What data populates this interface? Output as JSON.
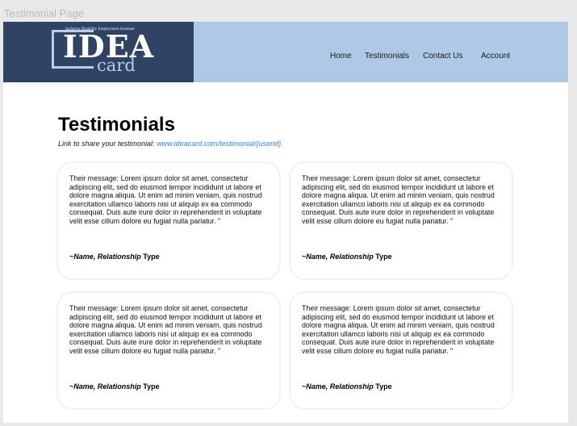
{
  "frame_label": "Testimonial Page",
  "logo": {
    "tagline": "Inclusive Disability Employment Assistant",
    "word1": "IDEA",
    "word2": "card"
  },
  "nav": {
    "home": "Home",
    "testimonials": "Testimonials",
    "contact": "Contact Us",
    "account": "Account"
  },
  "heading": "Testimonials",
  "share": {
    "label": "Link to share your testimonial:",
    "url": "www.ideacard.com/testimonial/{userid}"
  },
  "testimonials": [
    {
      "message": "Their message: Lorem ipsum dolor sit amet, consectetur adipiscing elit, sed do eiusmod tempor incididunt ut labore et dolore magna aliqua. Ut enim ad minim veniam, quis nostrud exercitation ullamco laboris nisi ut aliquip ex ea commodo consequat. Duis aute irure dolor in reprehenderit in voluptate velit esse cillum dolore eu fugiat nulla pariatur. \"",
      "signature": "~Name, Relationship",
      "type": "Type"
    },
    {
      "message": "Their message: Lorem ipsum dolor sit amet, consectetur adipiscing elit, sed do eiusmod tempor incididunt ut labore et dolore magna aliqua. Ut enim ad minim veniam, quis nostrud exercitation ullamco laboris nisi ut aliquip ex ea commodo consequat. Duis aute irure dolor in reprehenderit in voluptate velit esse cillum dolore eu fugiat nulla pariatur. \"",
      "signature": "~Name, Relationship",
      "type": "Type"
    },
    {
      "message": "Their message: Lorem ipsum dolor sit amet, consectetur adipiscing elit, sed do eiusmod tempor incididunt ut labore et dolore magna aliqua. Ut enim ad minim veniam, quis nostrud exercitation ullamco laboris nisi ut aliquip ex ea commodo consequat. Duis aute irure dolor in reprehenderit in voluptate velit esse cillum dolore eu fugiat nulla pariatur. \"",
      "signature": "~Name, Relationship",
      "type": "Type"
    },
    {
      "message": "Their message: Lorem ipsum dolor sit amet, consectetur adipiscing elit, sed do eiusmod tempor incididunt ut labore et dolore magna aliqua. Ut enim ad minim veniam, quis nostrud exercitation ullamco laboris nisi ut aliquip ex ea commodo consequat. Duis aute irure dolor in reprehenderit in voluptate velit esse cillum dolore eu fugiat nulla pariatur. \"",
      "signature": "~Name, Relationship",
      "type": "Type"
    }
  ],
  "colors": {
    "header_bg": "#aec8e6",
    "logo_bg": "#2f4364",
    "link": "#3b7fd0"
  }
}
